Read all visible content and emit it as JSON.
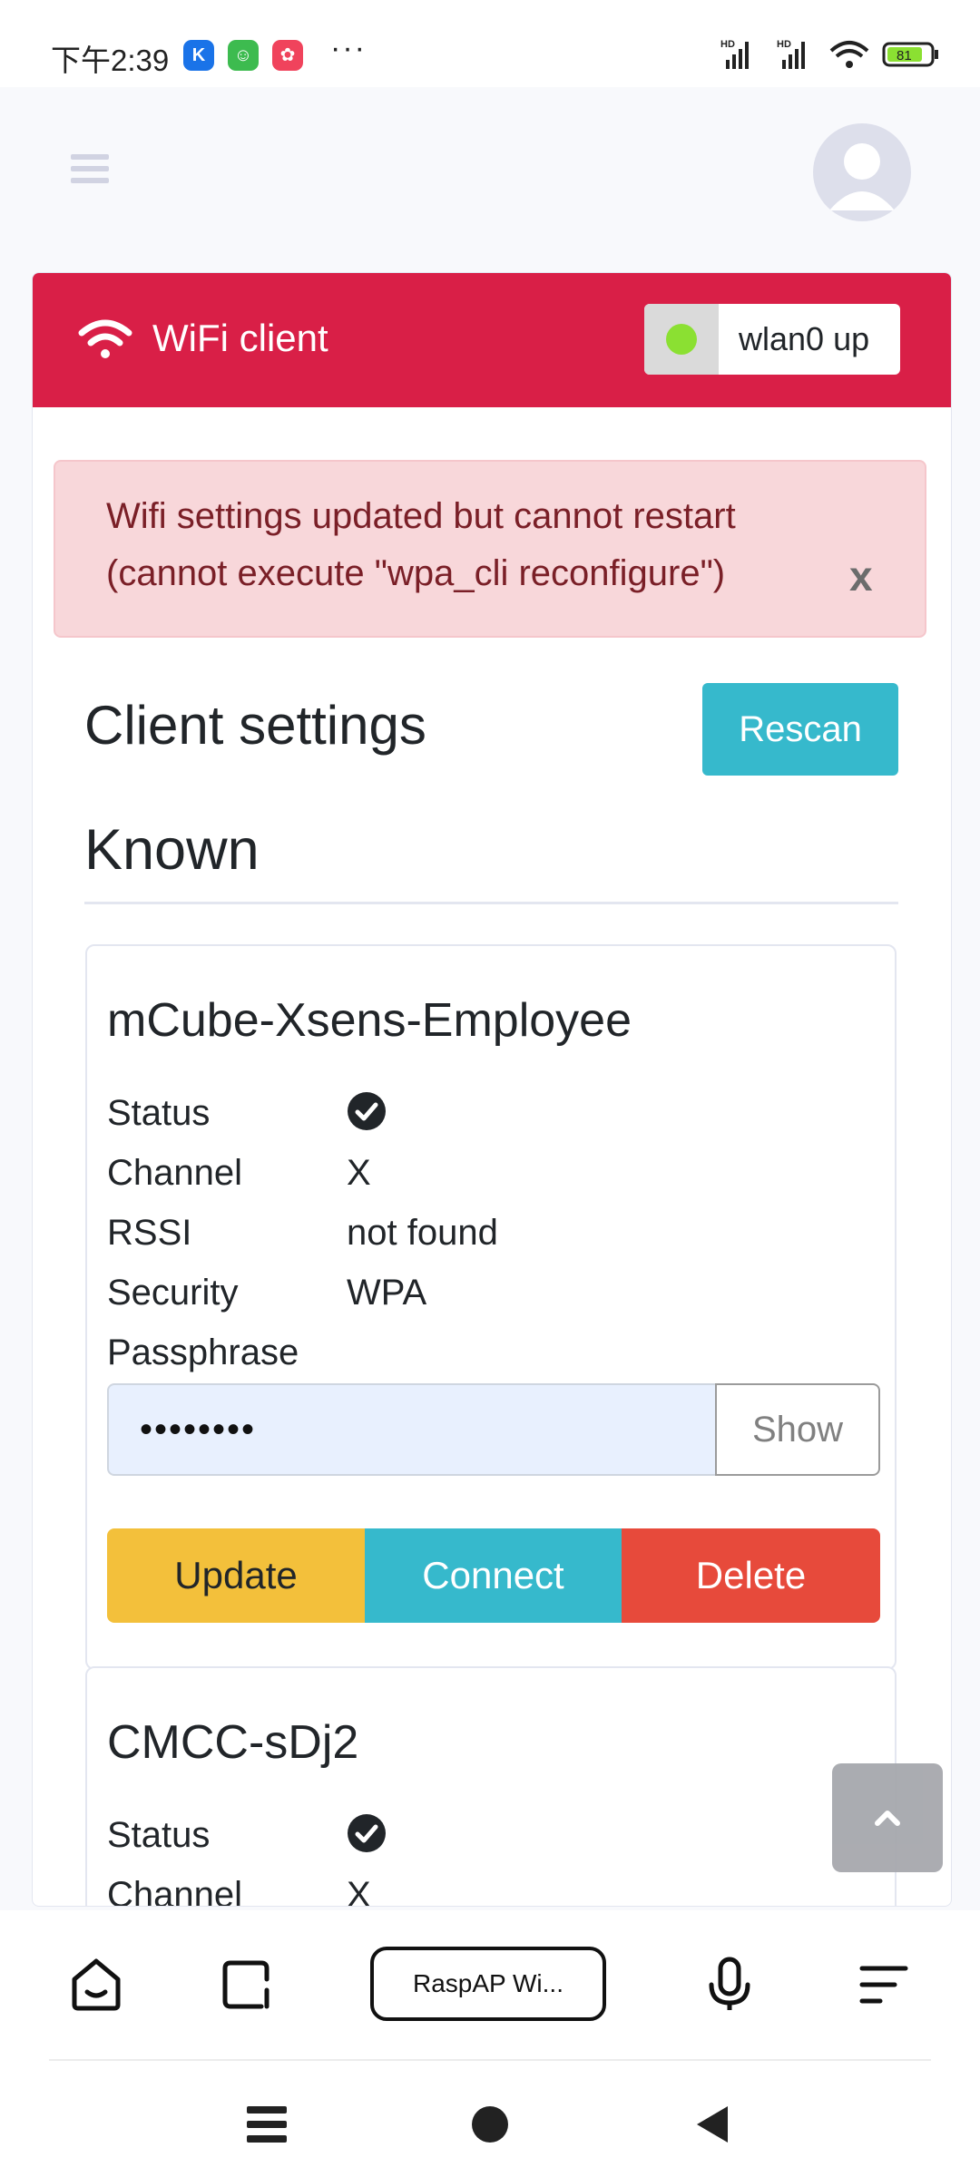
{
  "status_bar": {
    "time": "下午2:39",
    "apps": [
      {
        "name": "k-app",
        "glyph": "K",
        "color": "#1a73e8"
      },
      {
        "name": "green-app",
        "glyph": "☺",
        "color": "#3dbb4f"
      },
      {
        "name": "pink-app",
        "glyph": "✿",
        "color": "#f0435c"
      }
    ],
    "more": "···",
    "battery": "81"
  },
  "header": {
    "title": "WiFi client",
    "interface_status": "wlan0 up",
    "status_color": "#8be032"
  },
  "alert": {
    "line1": "Wifi settings updated but cannot restart",
    "line2": "(cannot execute \"wpa_cli reconfigure\")",
    "close": "x"
  },
  "section": {
    "title": "Client settings",
    "rescan": "Rescan",
    "known": "Known"
  },
  "networks": [
    {
      "ssid": "mCube-Xsens-Employee",
      "labels": {
        "status": "Status",
        "channel": "Channel",
        "rssi": "RSSI",
        "security": "Security",
        "passphrase": "Passphrase"
      },
      "channel": "X",
      "rssi": "not found",
      "security": "WPA",
      "passphrase_mask": "••••••••",
      "show": "Show",
      "update": "Update",
      "connect": "Connect",
      "delete": "Delete"
    },
    {
      "ssid": "CMCC-sDj2",
      "labels": {
        "status": "Status",
        "channel": "Channel"
      },
      "channel": "X"
    }
  ],
  "browser": {
    "tab_title": "RaspAP Wi..."
  },
  "colors": {
    "header_bg": "#d91f47",
    "info": "#36b9cc",
    "warning": "#f3c03b",
    "danger": "#e74a3b"
  }
}
